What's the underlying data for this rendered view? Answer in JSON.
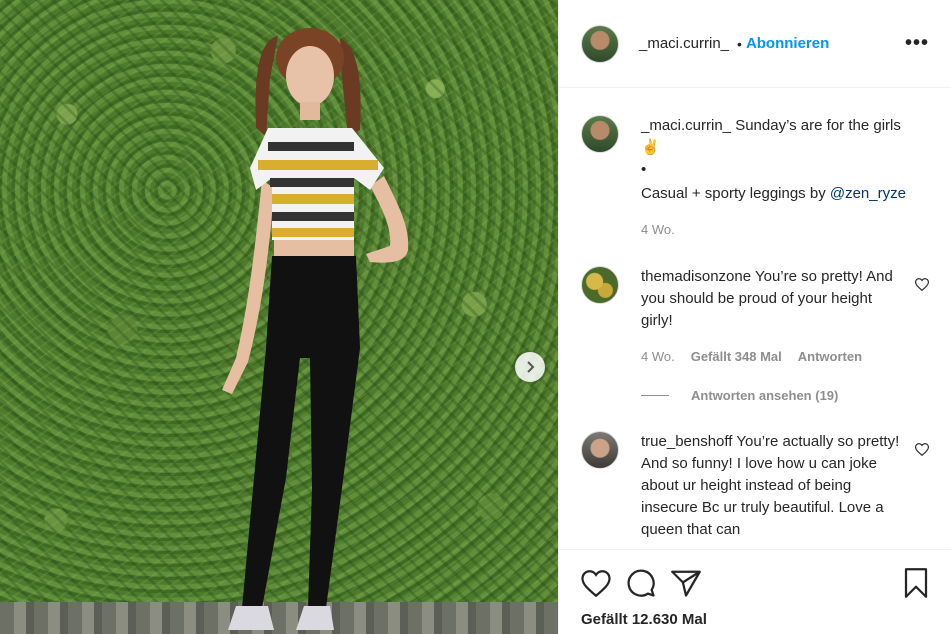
{
  "post": {
    "author": "_maci.currin_",
    "follow_label": "Abonnieren",
    "dot": "•",
    "more_icon": "more-icon",
    "next_icon": "chevron-right-icon"
  },
  "caption": {
    "username": "_maci.currin_",
    "line1": "Sunday’s are for the girls",
    "emoji": "✌",
    "bullet": "•",
    "line3_prefix": "Casual + sporty leggings by ",
    "mention": "@zen_ryze",
    "age": "4 Wo."
  },
  "comments": [
    {
      "username": "themadisonzone",
      "text": "You’re so pretty! And you should be proud of your height girly!",
      "age": "4 Wo.",
      "likes": "Gefällt 348 Mal",
      "reply_label": "Antworten",
      "view_replies": "Antworten ansehen (19)"
    },
    {
      "username": "true_benshoff",
      "text": "You’re actually so pretty! And so funny! I love how u can joke about ur height instead of being insecure Bc ur truly beautiful. Love a queen that can"
    }
  ],
  "actions": {
    "icons": [
      "heart-icon",
      "comment-icon",
      "share-icon",
      "bookmark-icon"
    ],
    "likes_text": "Gefällt 12.630 Mal"
  },
  "colors": {
    "accent": "#0095f6",
    "text": "#262626",
    "muted": "#8e8e8e",
    "mention": "#00376b"
  }
}
